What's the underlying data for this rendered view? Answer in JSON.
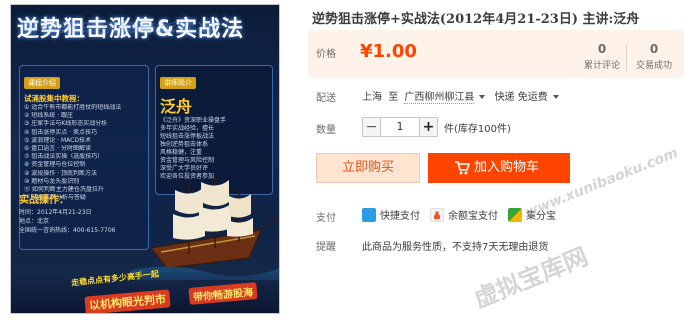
{
  "poster": {
    "title": "逆势狙击涨停&实战法",
    "left_badge": "课程介绍",
    "left_section": "试涌股集中教程：",
    "left_lines": [
      "① 适合牛熊市都能打胜仗的短线战法",
      "② 短线系统 · 跟庄",
      "③ 庄家手法与K线形态实战分析",
      "④ 狙击涨停买点 · 卖点技巧",
      "⑤ 波浪理论 · MACD技术",
      "⑥ 盘口语言 · 分时图解读",
      "⑦ 狙击战法实操（选股技巧）",
      "⑧ 资金管理与仓位控制",
      "⑨ 波段操作 · 顶底判断方法",
      "⑩ 题材与龙头股识别",
      "⑪ 如何判断主力建仓洗盘拉升",
      "⑫ 实盘案例分析与答疑"
    ],
    "right_badge": "讲师简介",
    "lecturer": "泛舟",
    "right_lines": [
      "《泛舟》资深职业操盘手",
      "多年实战经验，擅长",
      "短线狙击涨停板战法",
      "独创逆势狙击体系",
      "风格稳健，注重",
      "资金管理与风险控制",
      "深受广大学员好评",
      "欢迎各位投资者参加"
    ],
    "practice_heading": "实战操作：",
    "practice_lines": [
      "时间：2012年4月21-23日",
      "地点：北京",
      "全国统一咨询热线：400-615-7706"
    ],
    "slogan1": "走稳点点有多少高手一起",
    "slogan2": "以机构眼光判市",
    "slogan3": "带你畅游股海"
  },
  "product": {
    "title": "逆势狙击涨停+实战法(2012年4月21-23日) 主讲:泛舟",
    "price_label": "价格",
    "currency": "¥",
    "price": "1.00",
    "reviews_count": "0",
    "reviews_label": "累计评论",
    "sales_count": "0",
    "sales_label": "交易成功",
    "shipping_label": "配送",
    "ship_from": "上海",
    "ship_to_word": "至",
    "ship_to": "广西柳州柳江县",
    "ship_method": "快递 免运费",
    "quantity_label": "数量",
    "minus": "−",
    "quantity": "1",
    "plus": "+",
    "stock_text": "件(库存100件)",
    "buy_now": "立即购买",
    "add_to_cart": "加入购物车",
    "payment_label": "支付",
    "payments": [
      "快捷支付",
      "余额宝支付",
      "集分宝"
    ],
    "tips_label": "提醒",
    "tips_text": "此商品为服务性质，不支持7天无理由退货"
  },
  "watermarks": {
    "url": "www.xunibaoku.com",
    "site": "虚拟宝库网"
  },
  "colors": {
    "accent": "#ff4400",
    "price_bg": "#fff2e8",
    "buy_now_bg": "#ffe4d0"
  }
}
